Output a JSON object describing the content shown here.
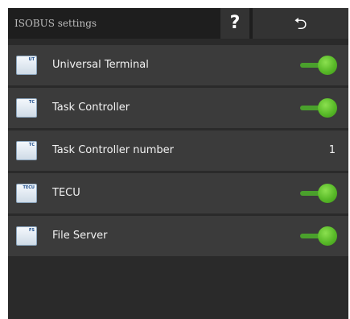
{
  "header": {
    "title": "ISOBUS settings",
    "help_label": "?",
    "back_label": "⮌"
  },
  "items": [
    {
      "label": "Universal Terminal",
      "icon_text": "UT",
      "icon": "ut-icon",
      "toggle_on": true
    },
    {
      "label": "Task Controller",
      "icon_text": "TC",
      "icon": "tc-icon",
      "toggle_on": true
    },
    {
      "label": "Task Controller number",
      "icon_text": "TC",
      "icon": "tc-number-icon",
      "value": "1"
    },
    {
      "label": "TECU",
      "icon_text": "TECU",
      "icon": "tecu-icon",
      "toggle_on": true
    },
    {
      "label": "File Server",
      "icon_text": "FS",
      "icon": "fs-icon",
      "toggle_on": true
    }
  ],
  "colors": {
    "background": "#2a2a2a",
    "row": "#3b3b3b",
    "toggle_on": "#58b928"
  }
}
